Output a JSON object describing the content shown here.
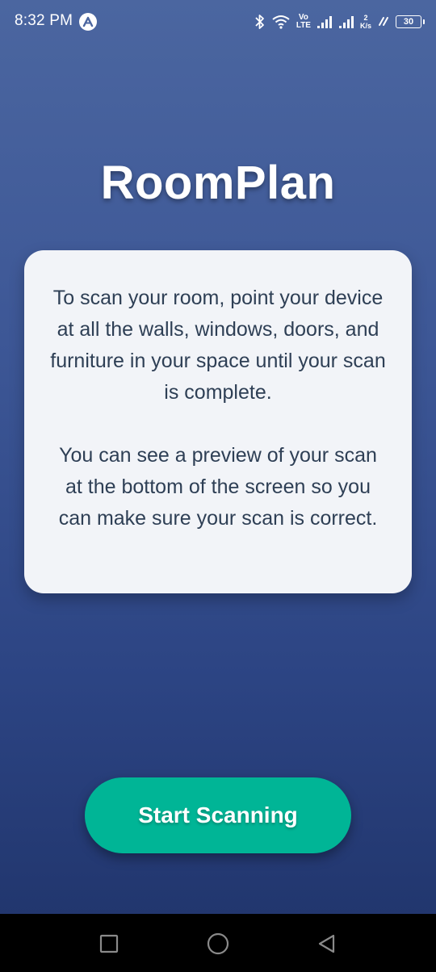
{
  "status_bar": {
    "time": "8:32 PM",
    "app_icon": "a-logo-icon",
    "volte_top": "Vo",
    "volte_bottom": "LTE",
    "net_speed_value": "2",
    "net_speed_unit": "K/s",
    "battery_level": "30"
  },
  "app": {
    "title": "RoomPlan"
  },
  "info_card": {
    "paragraph_1": "To scan your room, point your device at all the walls, windows, doors, and furniture in your space until your scan is complete.",
    "paragraph_2": "You can see a preview of your scan at the bottom of the screen so you can make sure your scan is correct."
  },
  "actions": {
    "start_label": "Start Scanning"
  },
  "navigation": {
    "recents": "square-recents-icon",
    "home": "circle-home-icon",
    "back": "triangle-back-icon"
  },
  "colors": {
    "background_top": "#4b66a0",
    "background_bottom": "#1f3369",
    "card_background": "#f2f4f8",
    "card_text": "#2e3f55",
    "button_accent": "#00b596"
  }
}
